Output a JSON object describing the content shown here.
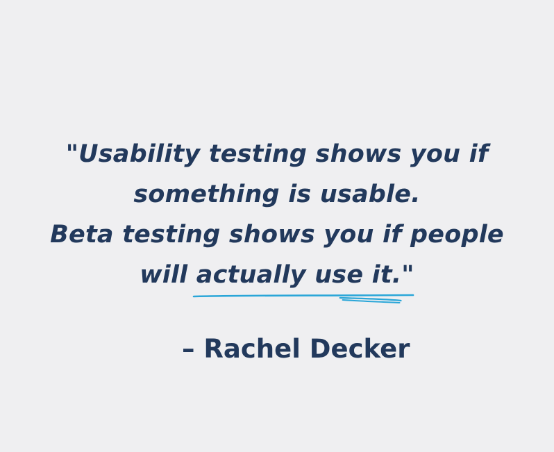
{
  "quote": {
    "line1": "\"Usability testing shows you if",
    "line2": "something is usable.",
    "line3": "Beta testing shows you if people",
    "line4_plain": "will ",
    "line4_highlight": "actually use it.\""
  },
  "attribution": {
    "text": "– Rachel Decker"
  },
  "colors": {
    "background": "#efeff1",
    "text": "#22395c",
    "accent_underline": "#2aa6d8"
  }
}
